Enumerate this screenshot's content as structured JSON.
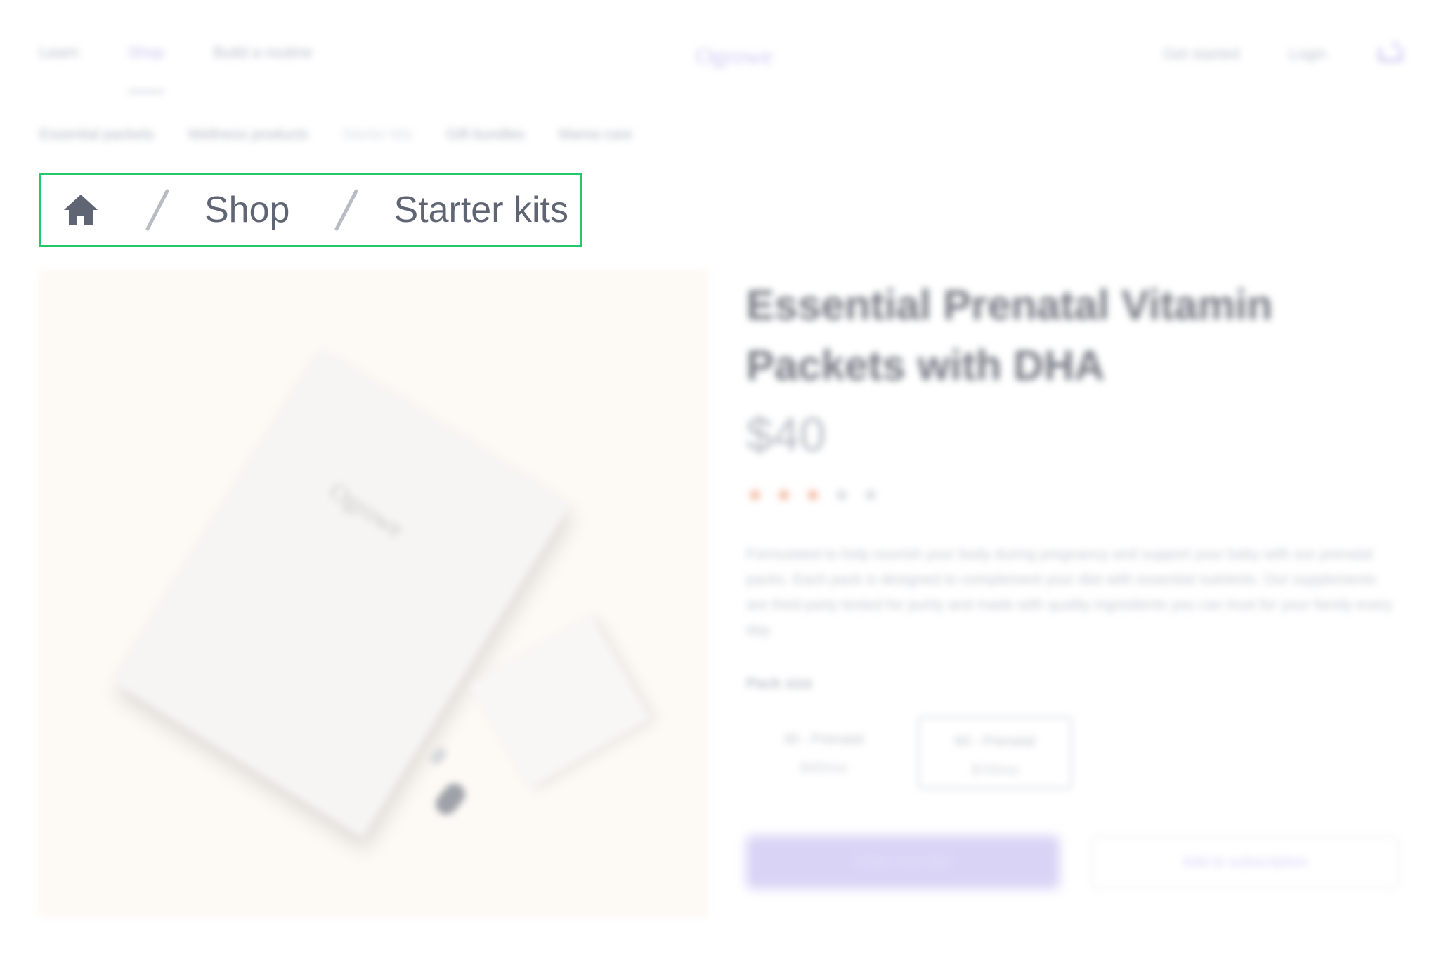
{
  "nav": {
    "left": [
      "Learn",
      "Shop",
      "Build a routine"
    ],
    "logo": "Ogrowe",
    "right": [
      "Get started",
      "Login"
    ],
    "cart_icon": "cart-icon"
  },
  "subnav": [
    "Essential packets",
    "Wellness products",
    "Starter kits",
    "Gift bundles",
    "Mama care"
  ],
  "breadcrumb": {
    "home_icon": "home-icon",
    "separator": "/",
    "shop": "Shop",
    "current": "Starter kits"
  },
  "product": {
    "title": "Essential Prenatal Vitamin Packets with DHA",
    "price": "$40",
    "rating": 3,
    "rating_max": 5,
    "description": "Formulated to help nourish your body during pregnancy and support your baby with our prenatal packs. Each pack is designed to complement your diet with essential nutrients. Our supplements are third-party tested for purity and made with quality ingredients you can trust for your family every day.",
    "pack_label": "Pack size",
    "options": [
      {
        "line1": "30 - Prenatal",
        "line2": "$40/mo",
        "selected": false
      },
      {
        "line1": "60 - Prenatal",
        "line2": "$70/mo",
        "selected": true
      }
    ],
    "primary_button": "Order now  $40",
    "secondary_button": "Add to subscription"
  },
  "colors": {
    "breadcrumb_highlight": "#23c86c",
    "accent": "#cfc8f2",
    "text": "#5f6573"
  }
}
